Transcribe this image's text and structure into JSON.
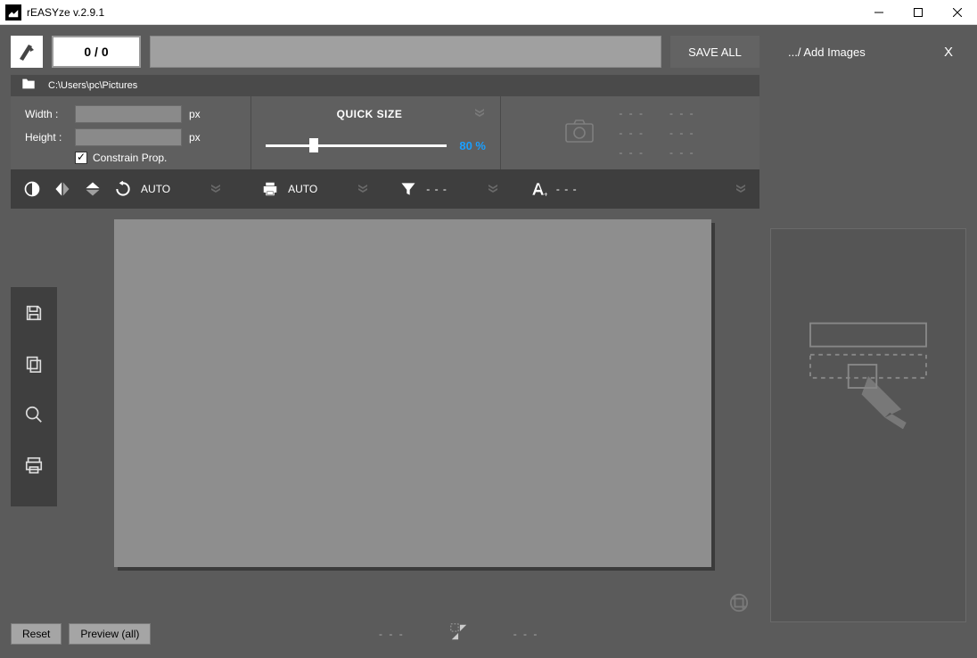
{
  "window": {
    "title": "rEASYze v.2.9.1"
  },
  "header": {
    "counter": "0 / 0",
    "save_all": "SAVE ALL",
    "add_images": ".../ Add Images",
    "close_x": "X"
  },
  "path": "C:\\Users\\pc\\Pictures",
  "dimensions": {
    "width_label": "Width :",
    "height_label": "Height :",
    "width_value": "",
    "height_value": "",
    "unit": "px",
    "constrain_label": "Constrain Prop.",
    "constrain_checked": true
  },
  "quicksize": {
    "title": "QUICK SIZE",
    "percent": "80 %"
  },
  "info": {
    "dash": "- - -"
  },
  "toolbar": {
    "rotate_auto": "AUTO",
    "print_auto": "AUTO",
    "filter_dash": "- - -",
    "text_dash": "- - -"
  },
  "bottom": {
    "reset": "Reset",
    "preview": "Preview (all)",
    "dash": "- - -"
  }
}
